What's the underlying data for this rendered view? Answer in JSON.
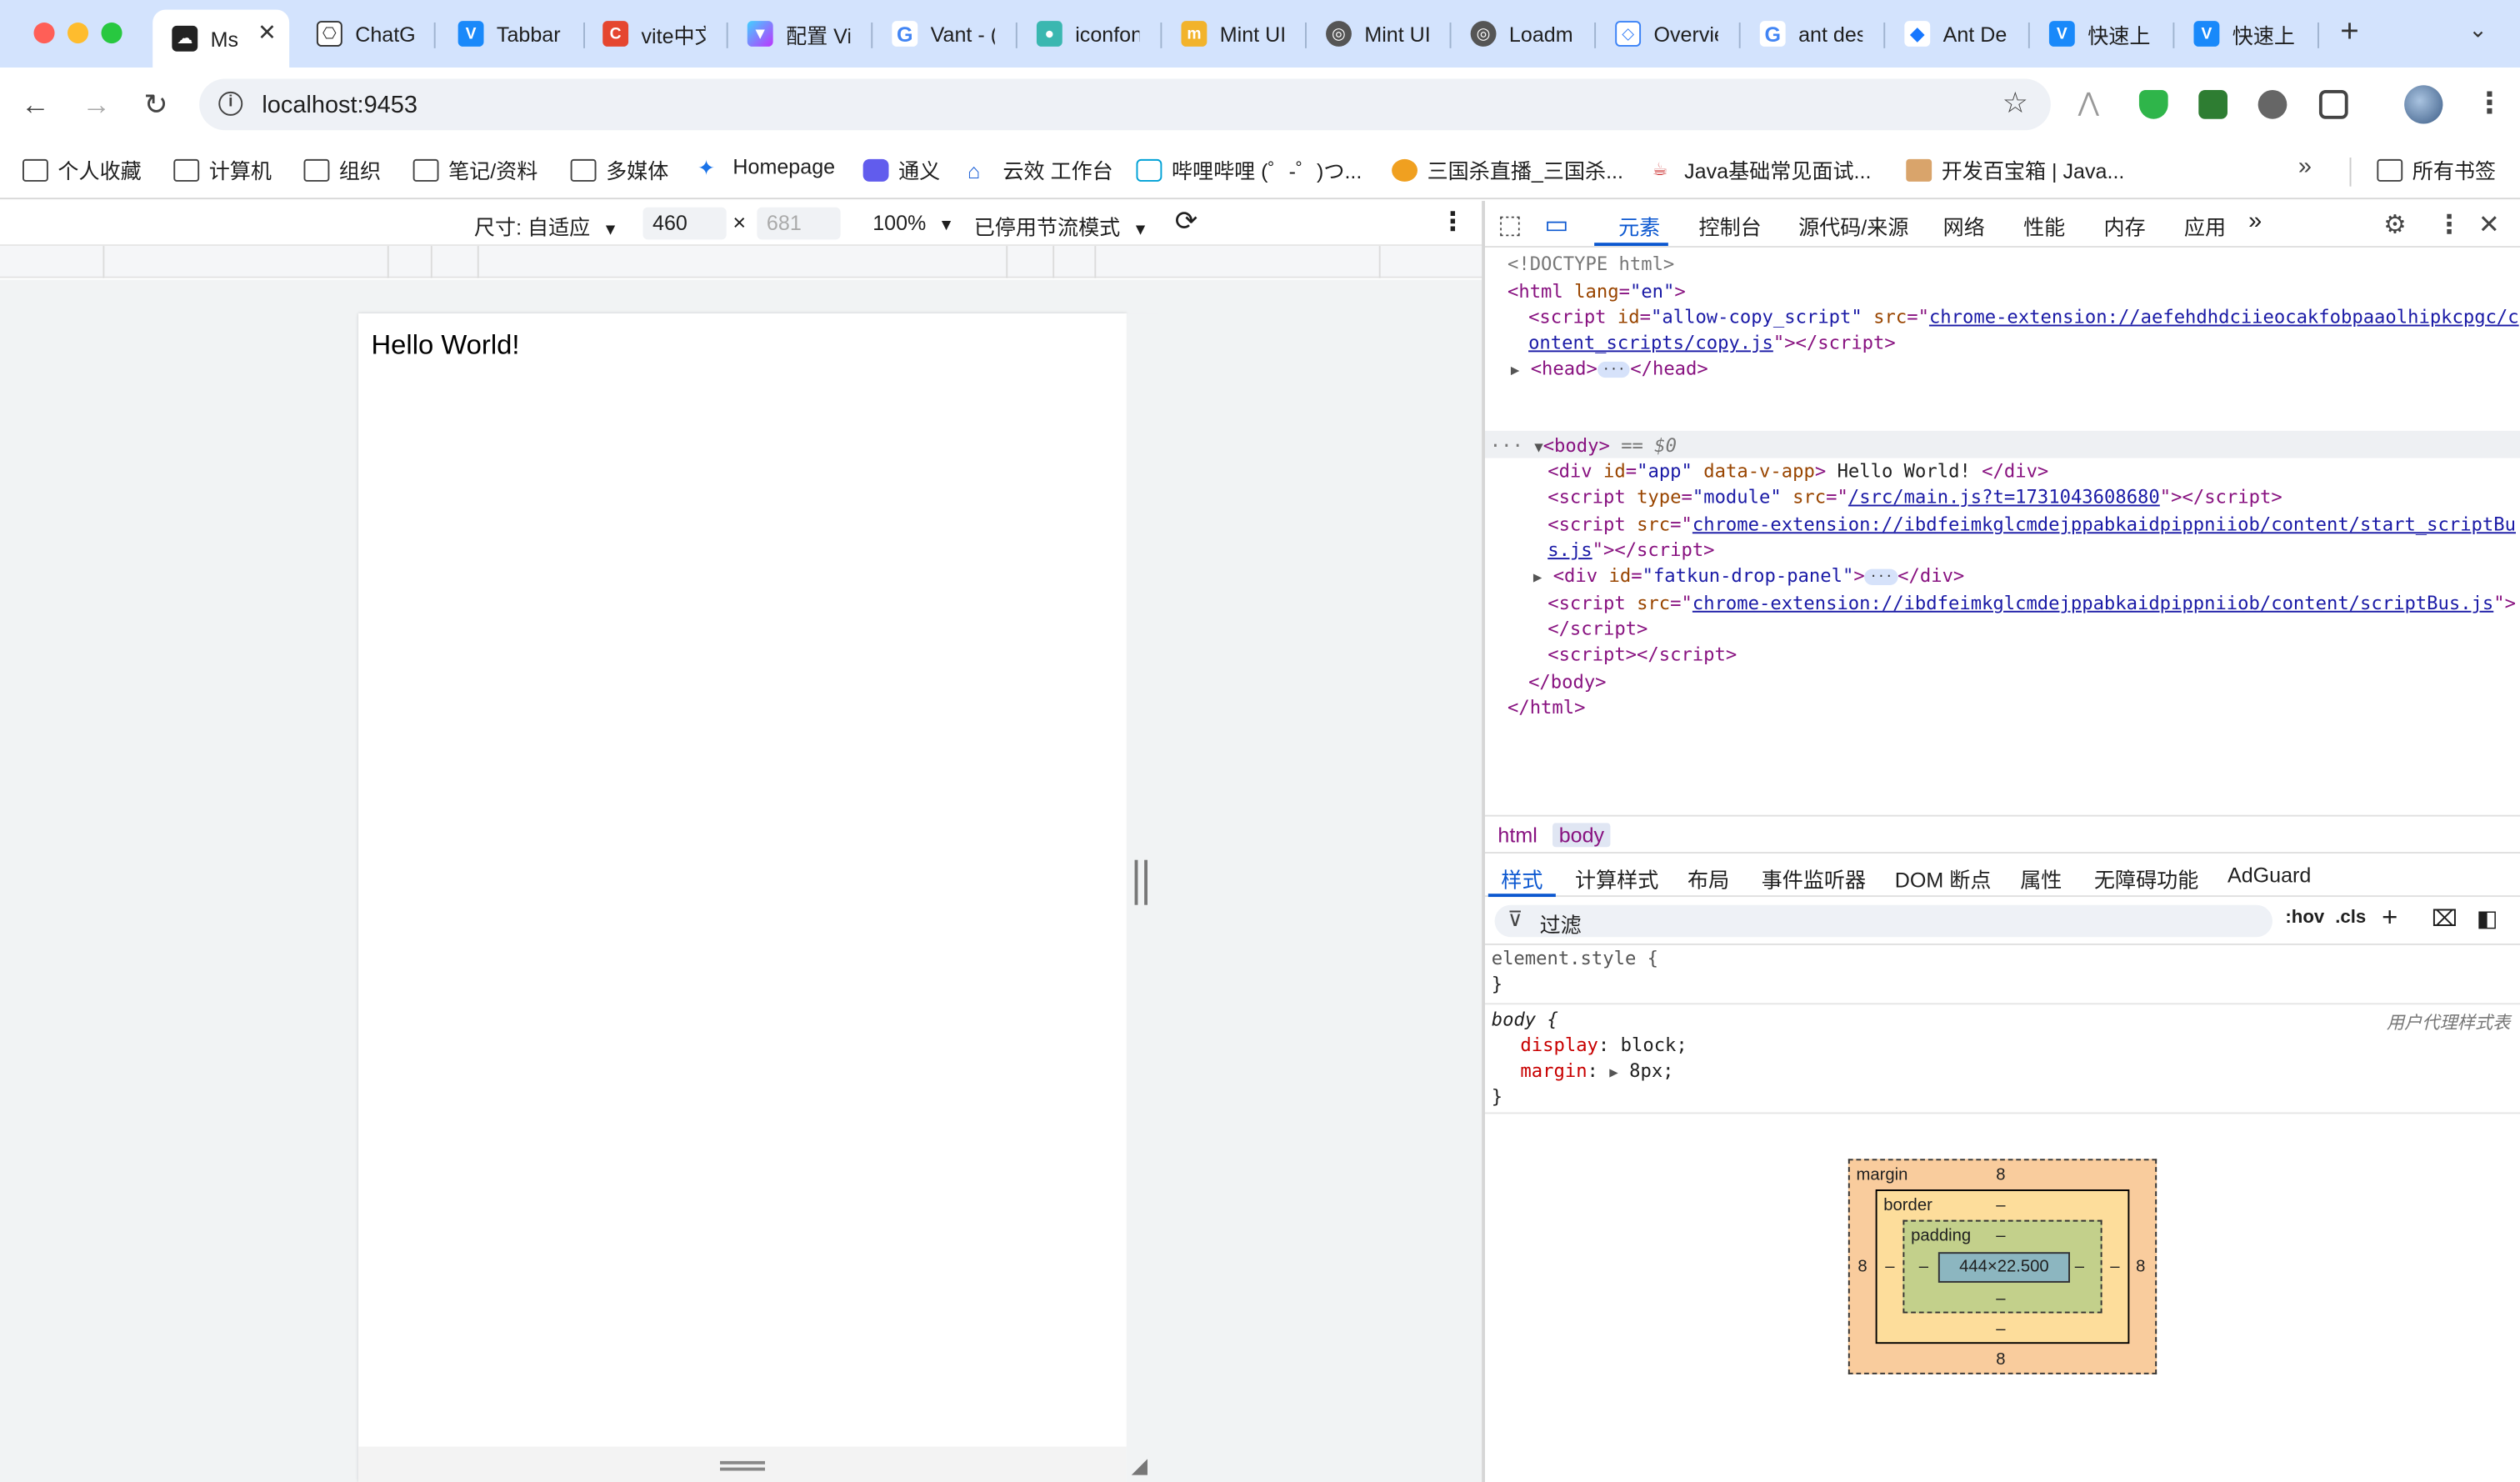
{
  "tabs": [
    {
      "label": "Ms",
      "favicon": "cloud-icon",
      "active": true
    },
    {
      "label": "ChatG",
      "favicon": "openai-icon"
    },
    {
      "label": "Tabbar",
      "favicon": "vant-icon"
    },
    {
      "label": "vite中文",
      "favicon": "csdn-icon"
    },
    {
      "label": "配置 Vi",
      "favicon": "vite-icon"
    },
    {
      "label": "Vant - (",
      "favicon": "google-icon"
    },
    {
      "label": "iconfon",
      "favicon": "iconfont-icon"
    },
    {
      "label": "Mint UI",
      "favicon": "mint-icon"
    },
    {
      "label": "Mint UI",
      "favicon": "globe-icon"
    },
    {
      "label": "Loadm",
      "favicon": "globe-icon"
    },
    {
      "label": "Overvie",
      "favicon": "overview-icon"
    },
    {
      "label": "ant des",
      "favicon": "google-icon"
    },
    {
      "label": "Ant De",
      "favicon": "antd-icon"
    },
    {
      "label": "快速上",
      "favicon": "vant-icon"
    },
    {
      "label": "快速上",
      "favicon": "vant-icon"
    }
  ],
  "toolbar": {
    "url": "localhost:9453"
  },
  "bookmarks": [
    {
      "label": "个人收藏",
      "icon": "folder-icon"
    },
    {
      "label": "计算机",
      "icon": "folder-icon"
    },
    {
      "label": "组织",
      "icon": "folder-icon"
    },
    {
      "label": "笔记/资料",
      "icon": "folder-icon"
    },
    {
      "label": "多媒体",
      "icon": "folder-icon"
    },
    {
      "label": "Homepage",
      "icon": "homepage-icon"
    },
    {
      "label": "通义",
      "icon": "tongyi-icon"
    },
    {
      "label": "云效 工作台",
      "icon": "yunxiao-icon"
    },
    {
      "label": "哔哩哔哩 (゜-゜)つ...",
      "icon": "bilibili-icon"
    },
    {
      "label": "三国杀直播_三国杀...",
      "icon": "sanguosha-icon"
    },
    {
      "label": "Java基础常见面试...",
      "icon": "java-icon"
    },
    {
      "label": "开发百宝箱 | Java...",
      "icon": "dev-icon"
    }
  ],
  "bookmarks_all": "所有书签",
  "device_toolbar": {
    "size_label": "尺寸: 自适应",
    "width": "460",
    "times": "×",
    "height": "681",
    "zoom": "100%",
    "throttle": "已停用节流模式"
  },
  "page_content": {
    "hello": "Hello World!"
  },
  "devtools": {
    "tabs": [
      "元素",
      "控制台",
      "源代码/来源",
      "网络",
      "性能",
      "内存",
      "应用"
    ],
    "more_tabs": "»",
    "dom": {
      "doctype": "<!DOCTYPE html>",
      "html_open": "<html",
      "html_lang_attr": "lang",
      "html_lang_val": "\"en\"",
      "script1_id": "\"allow-copy_script\"",
      "script1_src_a": "chrome-extension://aefehdhdciieocakfobpaaolhipkcpgc/c",
      "script1_src_b": "ontent_scripts/copy.js",
      "head": "<head>",
      "head_close": "</head>",
      "body_open": "<body>",
      "body_eq": "== $0",
      "app_div_id": "\"app\"",
      "app_div_attr": "data-v-app",
      "app_text": " Hello World! ",
      "main_src": "/src/main.js?t=1731043608680",
      "module": "\"module\"",
      "bus_src_a": "chrome-extension://ibdfeimkglcmdejppabkaidpippniiob/content/start_scriptBu",
      "bus_src_b": "s.js",
      "drop_panel_id": "\"fatkun-drop-panel\"",
      "bus2_src": "chrome-extension://ibdfeimkglcmdejppabkaidpippniiob/content/scriptBus.js"
    },
    "breadcrumbs": [
      "html",
      "body"
    ],
    "style_tabs": [
      "样式",
      "计算样式",
      "布局",
      "事件监听器",
      "DOM 断点",
      "属性",
      "无障碍功能",
      "AdGuard"
    ],
    "filter_placeholder": "过滤",
    "hov": ":hov",
    "cls": ".cls",
    "rules": {
      "element_style": "element.style {",
      "close_brace": "}",
      "body_selector": "body {",
      "ua_label": "用户代理样式表",
      "display_prop": "display",
      "display_val": "block;",
      "margin_prop": "margin",
      "margin_val": "8px;"
    },
    "box_model": {
      "margin_label": "margin",
      "border_label": "border",
      "padding_label": "padding",
      "content_size": "444×22.500",
      "margin_top": "8",
      "margin_bottom": "8",
      "margin_left": "8",
      "margin_right": "8",
      "border_value": "–",
      "padding_value": "–"
    }
  }
}
